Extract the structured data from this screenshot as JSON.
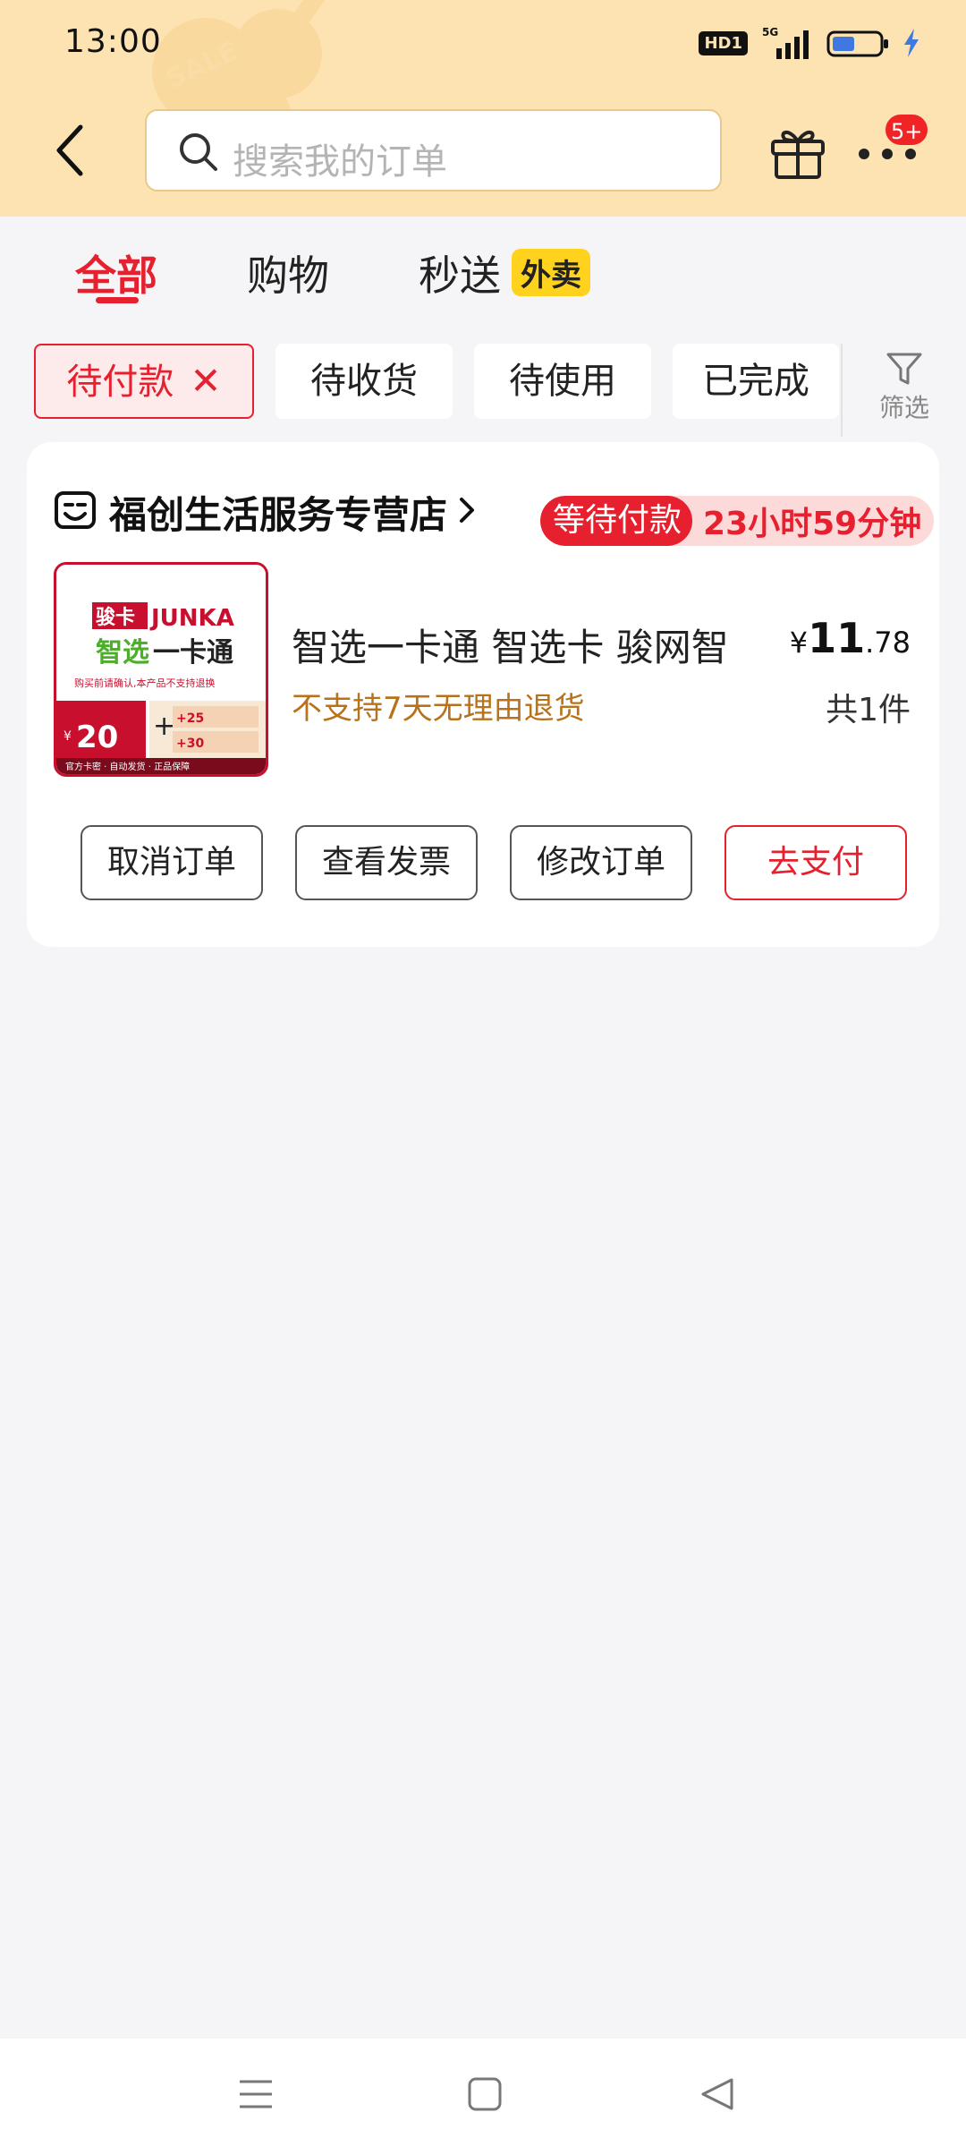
{
  "status_bar": {
    "time": "13:00",
    "hd_label": "HD1",
    "network": "5G"
  },
  "header": {
    "search_placeholder": "搜索我的订单",
    "message_badge": "5+"
  },
  "tabs": [
    {
      "label": "全部",
      "active": true
    },
    {
      "label": "购物",
      "active": false
    },
    {
      "label": "秒送",
      "active": false,
      "tag": "外卖"
    }
  ],
  "filter_chips": [
    {
      "label": "待付款",
      "active": true,
      "close_glyph": "✕"
    },
    {
      "label": "待收货",
      "active": false
    },
    {
      "label": "待使用",
      "active": false
    },
    {
      "label": "已完成",
      "active": false
    }
  ],
  "filter_button": {
    "label": "筛选"
  },
  "order": {
    "shop_name": "福创生活服务专营店",
    "status_label": "等待付款",
    "countdown": "23小时59分钟",
    "product_title": "智选一卡通 智选卡 骏网智",
    "product_note": "不支持7天无理由退货",
    "price_symbol": "¥",
    "price_int": "11",
    "price_dec": ".78",
    "quantity": "共1件",
    "thumbnail": {
      "brand_cn": "骏卡",
      "brand_en": "JUNKA",
      "title_a": "智选",
      "title_b": "一卡通",
      "disclaimer": "购买前请确认,本产品不支持退换",
      "face_symbol": "¥",
      "face_value": "20",
      "plus": "+",
      "coupon_1": "+25",
      "coupon_2": "+30",
      "footer": "官方卡密 · 自动发货 · 正品保障"
    },
    "actions": [
      {
        "label": "取消订单",
        "primary": false
      },
      {
        "label": "查看发票",
        "primary": false
      },
      {
        "label": "修改订单",
        "primary": false
      },
      {
        "label": "去支付",
        "primary": true
      }
    ]
  },
  "colors": {
    "accent": "#e6202e",
    "header_bg": "#fde3b2",
    "note": "#b87219",
    "tag_yellow": "#ffd21e"
  }
}
